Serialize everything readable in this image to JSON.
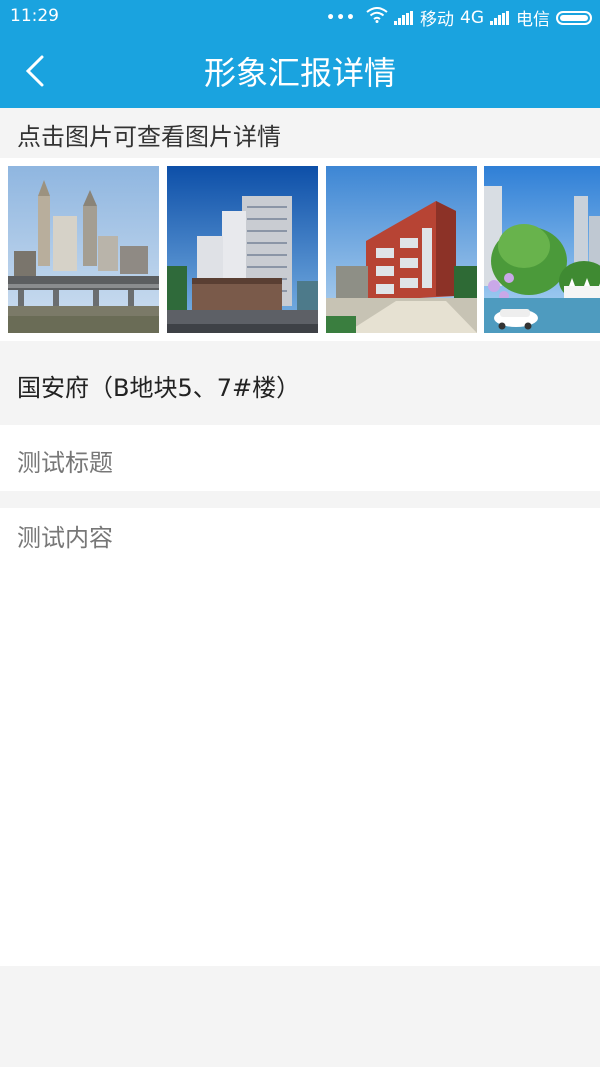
{
  "status_bar": {
    "time": "11:29",
    "carrier1": "移动",
    "network": "4G",
    "carrier2": "电信",
    "dots": "•••"
  },
  "header": {
    "title": "形象汇报详情",
    "back_icon": "chevron-left-icon"
  },
  "gallery": {
    "hint": "点击图片可查看图片详情",
    "photos": [
      {
        "name": "city-skyline-photo"
      },
      {
        "name": "residential-tower-photo"
      },
      {
        "name": "low-rise-building-photo"
      },
      {
        "name": "garden-community-photo"
      }
    ]
  },
  "report": {
    "project": "国安府（B地块5、7#楼）",
    "title": "测试标题",
    "content": "测试内容"
  },
  "colors": {
    "accent": "#1aa3df",
    "background": "#f4f4f4"
  }
}
